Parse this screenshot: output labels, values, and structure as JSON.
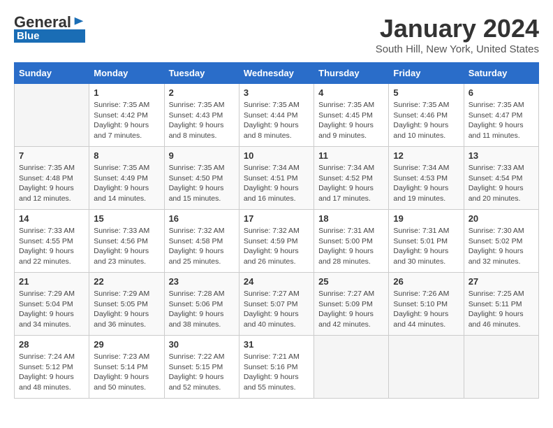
{
  "header": {
    "logo_line1": "General",
    "logo_line2": "Blue",
    "title": "January 2024",
    "subtitle": "South Hill, New York, United States"
  },
  "days_of_week": [
    "Sunday",
    "Monday",
    "Tuesday",
    "Wednesday",
    "Thursday",
    "Friday",
    "Saturday"
  ],
  "weeks": [
    [
      {
        "day": "",
        "info": ""
      },
      {
        "day": "1",
        "info": "Sunrise: 7:35 AM\nSunset: 4:42 PM\nDaylight: 9 hours\nand 7 minutes."
      },
      {
        "day": "2",
        "info": "Sunrise: 7:35 AM\nSunset: 4:43 PM\nDaylight: 9 hours\nand 8 minutes."
      },
      {
        "day": "3",
        "info": "Sunrise: 7:35 AM\nSunset: 4:44 PM\nDaylight: 9 hours\nand 8 minutes."
      },
      {
        "day": "4",
        "info": "Sunrise: 7:35 AM\nSunset: 4:45 PM\nDaylight: 9 hours\nand 9 minutes."
      },
      {
        "day": "5",
        "info": "Sunrise: 7:35 AM\nSunset: 4:46 PM\nDaylight: 9 hours\nand 10 minutes."
      },
      {
        "day": "6",
        "info": "Sunrise: 7:35 AM\nSunset: 4:47 PM\nDaylight: 9 hours\nand 11 minutes."
      }
    ],
    [
      {
        "day": "7",
        "info": "Sunrise: 7:35 AM\nSunset: 4:48 PM\nDaylight: 9 hours\nand 12 minutes."
      },
      {
        "day": "8",
        "info": "Sunrise: 7:35 AM\nSunset: 4:49 PM\nDaylight: 9 hours\nand 14 minutes."
      },
      {
        "day": "9",
        "info": "Sunrise: 7:35 AM\nSunset: 4:50 PM\nDaylight: 9 hours\nand 15 minutes."
      },
      {
        "day": "10",
        "info": "Sunrise: 7:34 AM\nSunset: 4:51 PM\nDaylight: 9 hours\nand 16 minutes."
      },
      {
        "day": "11",
        "info": "Sunrise: 7:34 AM\nSunset: 4:52 PM\nDaylight: 9 hours\nand 17 minutes."
      },
      {
        "day": "12",
        "info": "Sunrise: 7:34 AM\nSunset: 4:53 PM\nDaylight: 9 hours\nand 19 minutes."
      },
      {
        "day": "13",
        "info": "Sunrise: 7:33 AM\nSunset: 4:54 PM\nDaylight: 9 hours\nand 20 minutes."
      }
    ],
    [
      {
        "day": "14",
        "info": "Sunrise: 7:33 AM\nSunset: 4:55 PM\nDaylight: 9 hours\nand 22 minutes."
      },
      {
        "day": "15",
        "info": "Sunrise: 7:33 AM\nSunset: 4:56 PM\nDaylight: 9 hours\nand 23 minutes."
      },
      {
        "day": "16",
        "info": "Sunrise: 7:32 AM\nSunset: 4:58 PM\nDaylight: 9 hours\nand 25 minutes."
      },
      {
        "day": "17",
        "info": "Sunrise: 7:32 AM\nSunset: 4:59 PM\nDaylight: 9 hours\nand 26 minutes."
      },
      {
        "day": "18",
        "info": "Sunrise: 7:31 AM\nSunset: 5:00 PM\nDaylight: 9 hours\nand 28 minutes."
      },
      {
        "day": "19",
        "info": "Sunrise: 7:31 AM\nSunset: 5:01 PM\nDaylight: 9 hours\nand 30 minutes."
      },
      {
        "day": "20",
        "info": "Sunrise: 7:30 AM\nSunset: 5:02 PM\nDaylight: 9 hours\nand 32 minutes."
      }
    ],
    [
      {
        "day": "21",
        "info": "Sunrise: 7:29 AM\nSunset: 5:04 PM\nDaylight: 9 hours\nand 34 minutes."
      },
      {
        "day": "22",
        "info": "Sunrise: 7:29 AM\nSunset: 5:05 PM\nDaylight: 9 hours\nand 36 minutes."
      },
      {
        "day": "23",
        "info": "Sunrise: 7:28 AM\nSunset: 5:06 PM\nDaylight: 9 hours\nand 38 minutes."
      },
      {
        "day": "24",
        "info": "Sunrise: 7:27 AM\nSunset: 5:07 PM\nDaylight: 9 hours\nand 40 minutes."
      },
      {
        "day": "25",
        "info": "Sunrise: 7:27 AM\nSunset: 5:09 PM\nDaylight: 9 hours\nand 42 minutes."
      },
      {
        "day": "26",
        "info": "Sunrise: 7:26 AM\nSunset: 5:10 PM\nDaylight: 9 hours\nand 44 minutes."
      },
      {
        "day": "27",
        "info": "Sunrise: 7:25 AM\nSunset: 5:11 PM\nDaylight: 9 hours\nand 46 minutes."
      }
    ],
    [
      {
        "day": "28",
        "info": "Sunrise: 7:24 AM\nSunset: 5:12 PM\nDaylight: 9 hours\nand 48 minutes."
      },
      {
        "day": "29",
        "info": "Sunrise: 7:23 AM\nSunset: 5:14 PM\nDaylight: 9 hours\nand 50 minutes."
      },
      {
        "day": "30",
        "info": "Sunrise: 7:22 AM\nSunset: 5:15 PM\nDaylight: 9 hours\nand 52 minutes."
      },
      {
        "day": "31",
        "info": "Sunrise: 7:21 AM\nSunset: 5:16 PM\nDaylight: 9 hours\nand 55 minutes."
      },
      {
        "day": "",
        "info": ""
      },
      {
        "day": "",
        "info": ""
      },
      {
        "day": "",
        "info": ""
      }
    ]
  ]
}
